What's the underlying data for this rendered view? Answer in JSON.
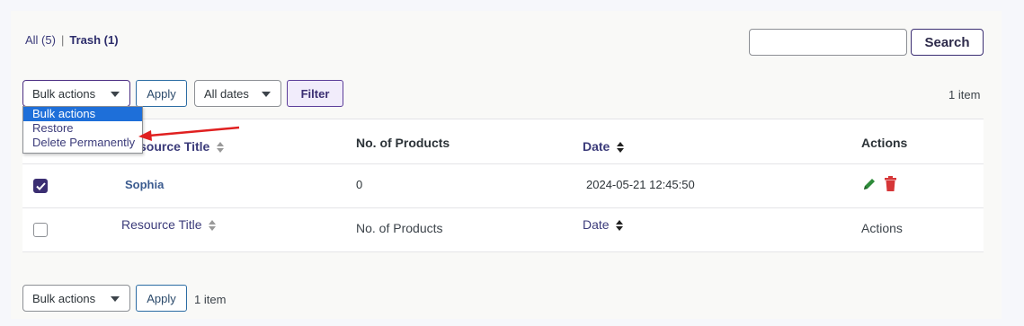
{
  "views": {
    "all": "All (5)",
    "separator": "|",
    "trash": "Trash (1)"
  },
  "search": {
    "value": "",
    "button_label": "Search"
  },
  "top_bar": {
    "bulk_actions_label": "Bulk actions",
    "apply_label": "Apply",
    "dates_label": "All dates",
    "filter_label": "Filter",
    "item_count": "1 item"
  },
  "dropdown": {
    "options": [
      "Bulk actions",
      "Restore",
      "Delete Permanently"
    ],
    "selected_index": 0
  },
  "table": {
    "columns": {
      "title": "Resource Title",
      "products": "No. of Products",
      "date": "Date",
      "actions": "Actions"
    },
    "title_header_visible": "source Title",
    "rows": [
      {
        "checked": true,
        "title": "Sophia",
        "products": "0",
        "date": "2024-05-21 12:45:50"
      }
    ]
  },
  "bottom_bar": {
    "bulk_actions_label": "Bulk actions",
    "apply_label": "Apply",
    "item_count": "1 item"
  },
  "colors": {
    "accent": "#3b2e72",
    "edit_icon": "#2e8b3a",
    "delete_icon": "#d63638",
    "dropdown_selected": "#1e6fd9",
    "arrow": "#e02020"
  }
}
